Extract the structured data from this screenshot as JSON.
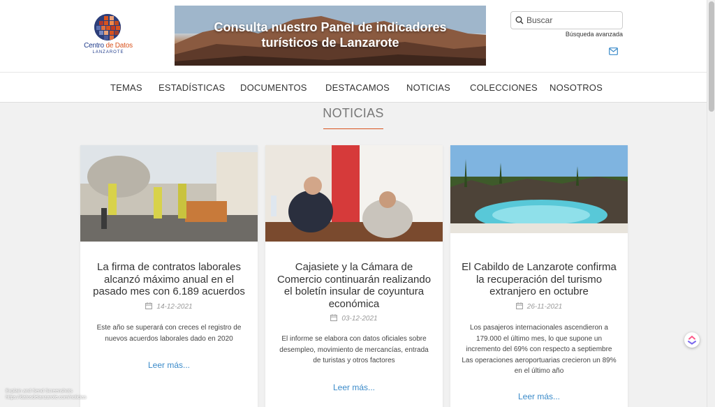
{
  "brand": {
    "title_part1": "Centro ",
    "title_part2": "de Datos",
    "subtitle": "LANZAROTE",
    "colors": {
      "primary": "#1e3a8a",
      "accent": "#d9531e"
    }
  },
  "banner": {
    "line1": "Consulta nuestro Panel de indicadores",
    "line2": "turísticos de Lanzarote"
  },
  "search": {
    "placeholder": "Buscar",
    "advanced_label": "Búsqueda avanzada",
    "icon": "search-icon"
  },
  "contact": {
    "icon": "mail-icon"
  },
  "nav": {
    "items": [
      {
        "label": "TEMAS"
      },
      {
        "label": "ESTADÍSTICAS"
      },
      {
        "label": "DOCUMENTOS"
      },
      {
        "label": "DESTACAMOS"
      },
      {
        "label": "NOTICIAS"
      },
      {
        "label": "COLECCIONES"
      },
      {
        "label": "NOSOTROS"
      }
    ]
  },
  "section": {
    "title": "NOTICIAS"
  },
  "articles": [
    {
      "title": "La firma de contratos laborales alcanzó máximo anual en el pasado mes con 6.189 acuerdos",
      "date": "14-12-2021",
      "summary": "Este año se superará con creces el registro de nuevos acuerdos laborales dado en 2020",
      "read_more": "Leer más..."
    },
    {
      "title": "Cajasiete y la Cámara de Comercio continuarán realizando el boletín insular de coyuntura económica",
      "date": "03-12-2021",
      "summary": "El informe se elabora con datos oficiales sobre desempleo, movimiento de mercancías, entrada de turistas y otros factores",
      "read_more": "Leer más..."
    },
    {
      "title": "El Cabildo de Lanzarote confirma la recuperación del turismo extranjero en octubre",
      "date": "26-11-2021",
      "summary": "Los pasajeros internacionales ascendieron a 179.000 el último mes, lo que supone un incremento del 69% con respecto a septiembre Las operaciones aeroportuarias crecieron un 89% en el último año",
      "read_more": "Leer más..."
    }
  ],
  "overlay": {
    "line1": "Explain and Send Screenshots",
    "line2": "https://datosdelanzarote.com/noticias"
  },
  "colors": {
    "link": "#3a8ac9",
    "rule": "#d9531e",
    "background": "#f1f1f1"
  }
}
